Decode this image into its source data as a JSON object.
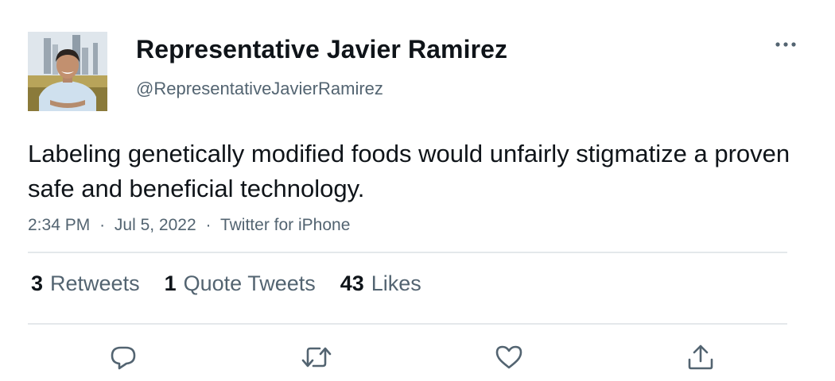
{
  "user": {
    "display_name": "Representative Javier Ramirez",
    "handle": "@RepresentativeJavierRamirez"
  },
  "tweet": {
    "text": "Labeling genetically modified foods would unfairly stigmatize a proven safe and beneficial technology.",
    "time": "2:34 PM",
    "date": "Jul 5, 2022",
    "source": "Twitter for iPhone",
    "separator": "·"
  },
  "stats": [
    {
      "count": "3",
      "label": "Retweets"
    },
    {
      "count": "1",
      "label": "Quote Tweets"
    },
    {
      "count": "43",
      "label": "Likes"
    }
  ],
  "icons": {
    "more": "more-horizontal-icon",
    "reply": "reply-icon",
    "retweet": "retweet-icon",
    "like": "heart-icon",
    "share": "share-icon"
  },
  "colors": {
    "text": "#0f1419",
    "secondary": "#536471",
    "divider": "#e4e8eb"
  }
}
